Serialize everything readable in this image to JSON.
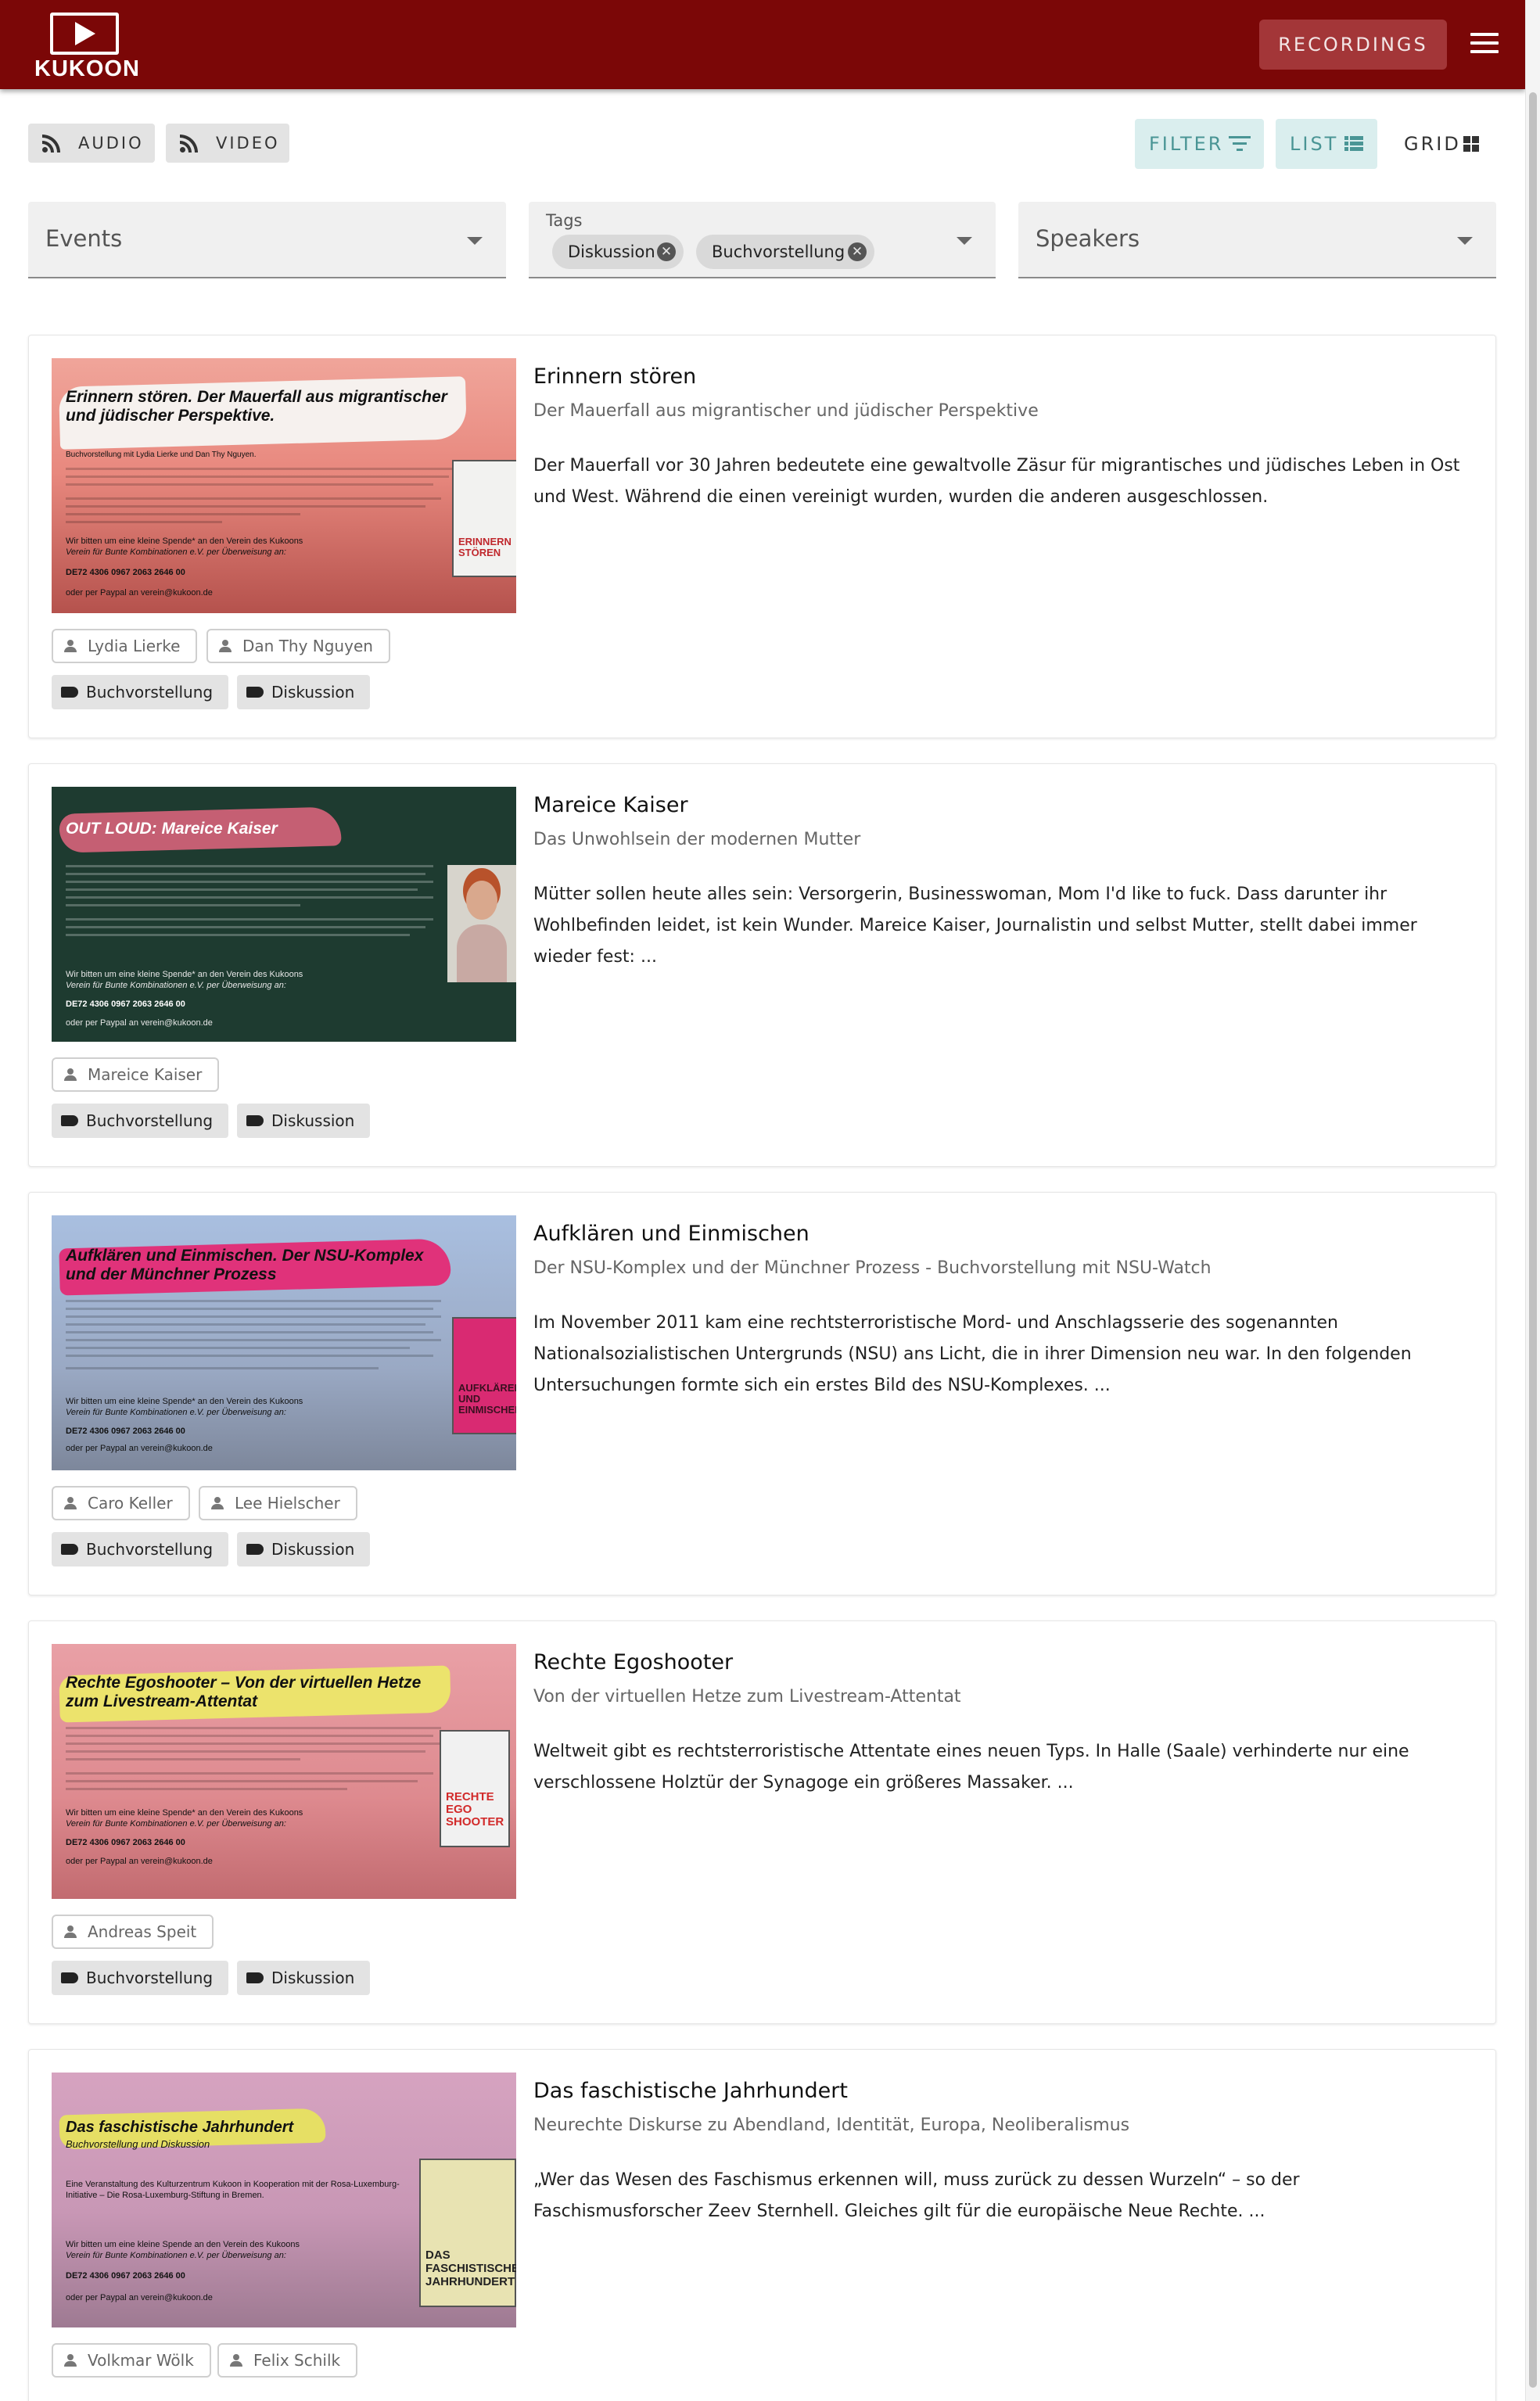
{
  "header": {
    "logo_text": "KUKOON",
    "recordings_label": "RECORDINGS"
  },
  "feeds": {
    "audio_label": "AUDIO",
    "video_label": "VIDEO"
  },
  "view": {
    "filter_label": "FILTER",
    "list_label": "LIST",
    "grid_label": "GRID"
  },
  "filters": {
    "events_placeholder": "Events",
    "tags_label": "Tags",
    "tags_selected": [
      "Diskussion",
      "Buchvorstellung"
    ],
    "speakers_placeholder": "Speakers"
  },
  "colors": {
    "brand": "#7b0707",
    "accent": "#4a9595"
  },
  "cards": [
    {
      "title": "Erinnern stören",
      "subtitle": "Der Mauerfall aus migrantischer und jüdischer Perspektive",
      "description": "Der Mauerfall vor 30 Jahren bedeutete eine gewaltvolle Zäsur für migrantisches und jüdisches Leben in Ost und West. Während die einen vereinigt wurden, wurden die anderen ausgeschlossen.",
      "speakers": [
        "Lydia Lierke",
        "Dan Thy Nguyen"
      ],
      "tags": [
        "Buchvorstellung",
        "Diskussion"
      ],
      "thumb": {
        "headline": "Erinnern stören. Der Mauerfall aus migrantischer und jüdischer Perspektive.",
        "intro": "Buchvorstellung mit Lydia Lierke und Dan Thy Nguyen.",
        "donation": "Wir bitten um eine kleine Spende* an den Verein des Kukoons",
        "donation2": "Verein für Bunte Kombinationen e.V. per Überweisung an:",
        "iban": "DE72 4306 0967 2063 2646 00",
        "paypal": "oder per Paypal an verein@kukoon.de",
        "book_title": "ERINNERN STÖREN"
      }
    },
    {
      "title": "Mareice Kaiser",
      "subtitle": "Das Unwohlsein der modernen Mutter",
      "description": "Mütter sollen heute alles sein: Versorgerin, Businesswoman, Mom I'd like to fuck. Dass darunter ihr Wohlbefinden leidet, ist kein Wunder. Mareice Kaiser, Journalistin und selbst Mutter, stellt dabei immer wieder fest: ...",
      "speakers": [
        "Mareice Kaiser"
      ],
      "tags": [
        "Buchvorstellung",
        "Diskussion"
      ],
      "thumb": {
        "headline": "OUT LOUD: Mareice Kaiser",
        "donation": "Wir bitten um eine kleine Spende* an den Verein des Kukoons",
        "donation2": "Verein für Bunte Kombinationen e.V. per Überweisung an:",
        "iban": "DE72 4306 0967 2063 2646 00",
        "paypal": "oder per Paypal an verein@kukoon.de"
      }
    },
    {
      "title": "Aufklären und Einmischen",
      "subtitle": "Der NSU-Komplex und der Münchner Prozess - Buchvorstellung mit NSU-Watch",
      "description": "Im November 2011 kam eine rechtsterroristische Mord- und Anschlagsserie des sogenannten Nationalsozialistischen Untergrunds (NSU) ans Licht, die in ihrer Dimension neu war. In den folgenden Untersuchungen formte sich ein erstes Bild des NSU-Komplexes. ...",
      "speakers": [
        "Caro Keller",
        "Lee Hielscher"
      ],
      "tags": [
        "Buchvorstellung",
        "Diskussion"
      ],
      "thumb": {
        "headline": "Aufklären und Einmischen. Der NSU-Komplex und der Münchner Prozess",
        "donation": "Wir bitten um eine kleine Spende* an den Verein des Kukoons",
        "donation2": "Verein für Bunte Kombinationen e.V. per Überweisung an:",
        "iban": "DE72 4306 0967 2063 2646 00",
        "paypal": "oder per Paypal an verein@kukoon.de",
        "book_title": "AUFKLÄREN UND EINMISCHEN"
      }
    },
    {
      "title": "Rechte Egoshooter",
      "subtitle": "Von der virtuellen Hetze zum Livestream-Attentat",
      "description": "Weltweit gibt es rechtsterroristische Attentate eines neuen Typs. In Halle (Saale) verhinderte nur eine verschlossene Holztür der Synagoge ein größeres Massaker. ...",
      "speakers": [
        "Andreas Speit"
      ],
      "tags": [
        "Buchvorstellung",
        "Diskussion"
      ],
      "thumb": {
        "headline": "Rechte Egoshooter – Von der virtuellen Hetze zum Livestream-Attentat",
        "donation": "Wir bitten um eine kleine Spende* an den Verein des Kukoons",
        "donation2": "Verein für Bunte Kombinationen e.V. per Überweisung an:",
        "iban": "DE72 4306 0967 2063 2646 00",
        "paypal": "oder per Paypal an verein@kukoon.de",
        "book_title": "RECHTE EGO SHOOTER"
      }
    },
    {
      "title": "Das faschistische Jahrhundert",
      "subtitle": "Neurechte Diskurse zu Abendland, Identität, Europa, Neoliberalismus",
      "description": "„Wer das Wesen des Faschismus erkennen will, muss zurück zu dessen Wurzeln“ – so der Faschismusforscher Zeev Sternhell. Gleiches gilt für die europäische Neue Rechte. ...",
      "speakers": [
        "Volkmar Wölk",
        "Felix Schilk"
      ],
      "tags": [],
      "thumb": {
        "headline": "Das faschistische Jahrhundert",
        "subhead": "Buchvorstellung und Diskussion",
        "intro": "Eine Veranstaltung des Kulturzentrum Kukoon in Kooperation mit der Rosa-Luxemburg-Initiative – Die Rosa-Luxemburg-Stiftung in Bremen.",
        "donation": "Wir bitten um eine kleine Spende an den Verein des Kukoons",
        "donation2": "Verein für Bunte Kombinationen e.V. per Überweisung an:",
        "iban": "DE72 4306 0967 2063 2646 00",
        "paypal": "oder per Paypal an verein@kukoon.de",
        "book_title": "DAS FASCHISTISCHE JAHRHUNDERT"
      }
    }
  ]
}
